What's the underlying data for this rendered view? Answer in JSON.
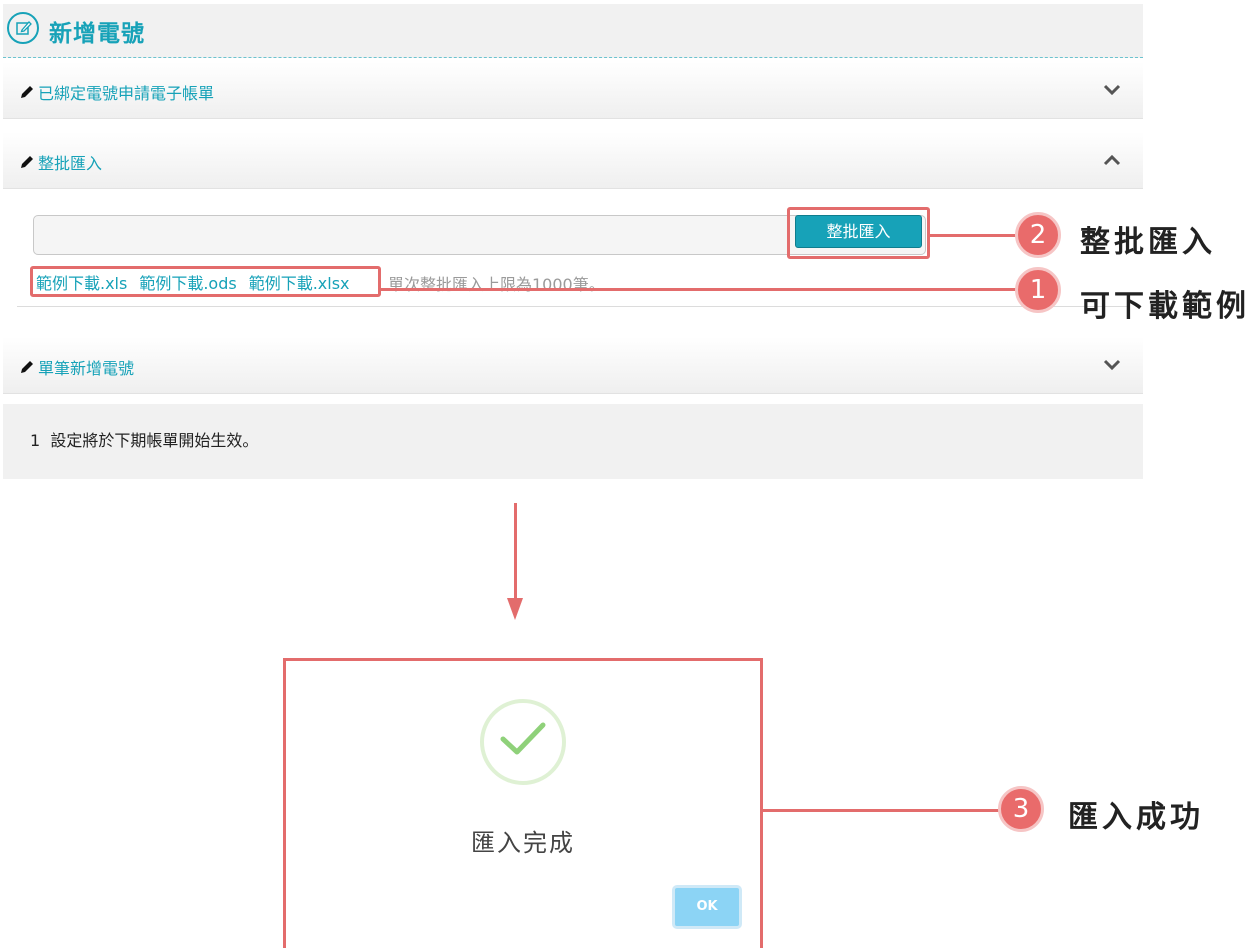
{
  "page": {
    "title": "新增電號"
  },
  "accordions": [
    {
      "label": "已綁定電號申請電子帳單",
      "expanded": false
    },
    {
      "label": "整批匯入",
      "expanded": true
    },
    {
      "label": "單筆新增電號",
      "expanded": false
    }
  ],
  "batch_import": {
    "button_label": "整批匯入",
    "links": [
      "範例下載.xls",
      "範例下載.ods",
      "範例下載.xlsx"
    ],
    "hint": "單次整批匯入上限為1000筆。"
  },
  "note": {
    "number": "1",
    "text": "設定將於下期帳單開始生效。"
  },
  "callouts": [
    {
      "number": "2",
      "text": "整批匯入"
    },
    {
      "number": "1",
      "text": "可下載範例"
    },
    {
      "number": "3",
      "text": "匯入成功"
    }
  ],
  "dialog": {
    "message": "匯入完成",
    "ok_label": "OK"
  },
  "colors": {
    "accent": "#17a2b8",
    "highlight": "#e36c6c",
    "success": "#8fd17a",
    "ok_button": "#8cd4f5"
  }
}
